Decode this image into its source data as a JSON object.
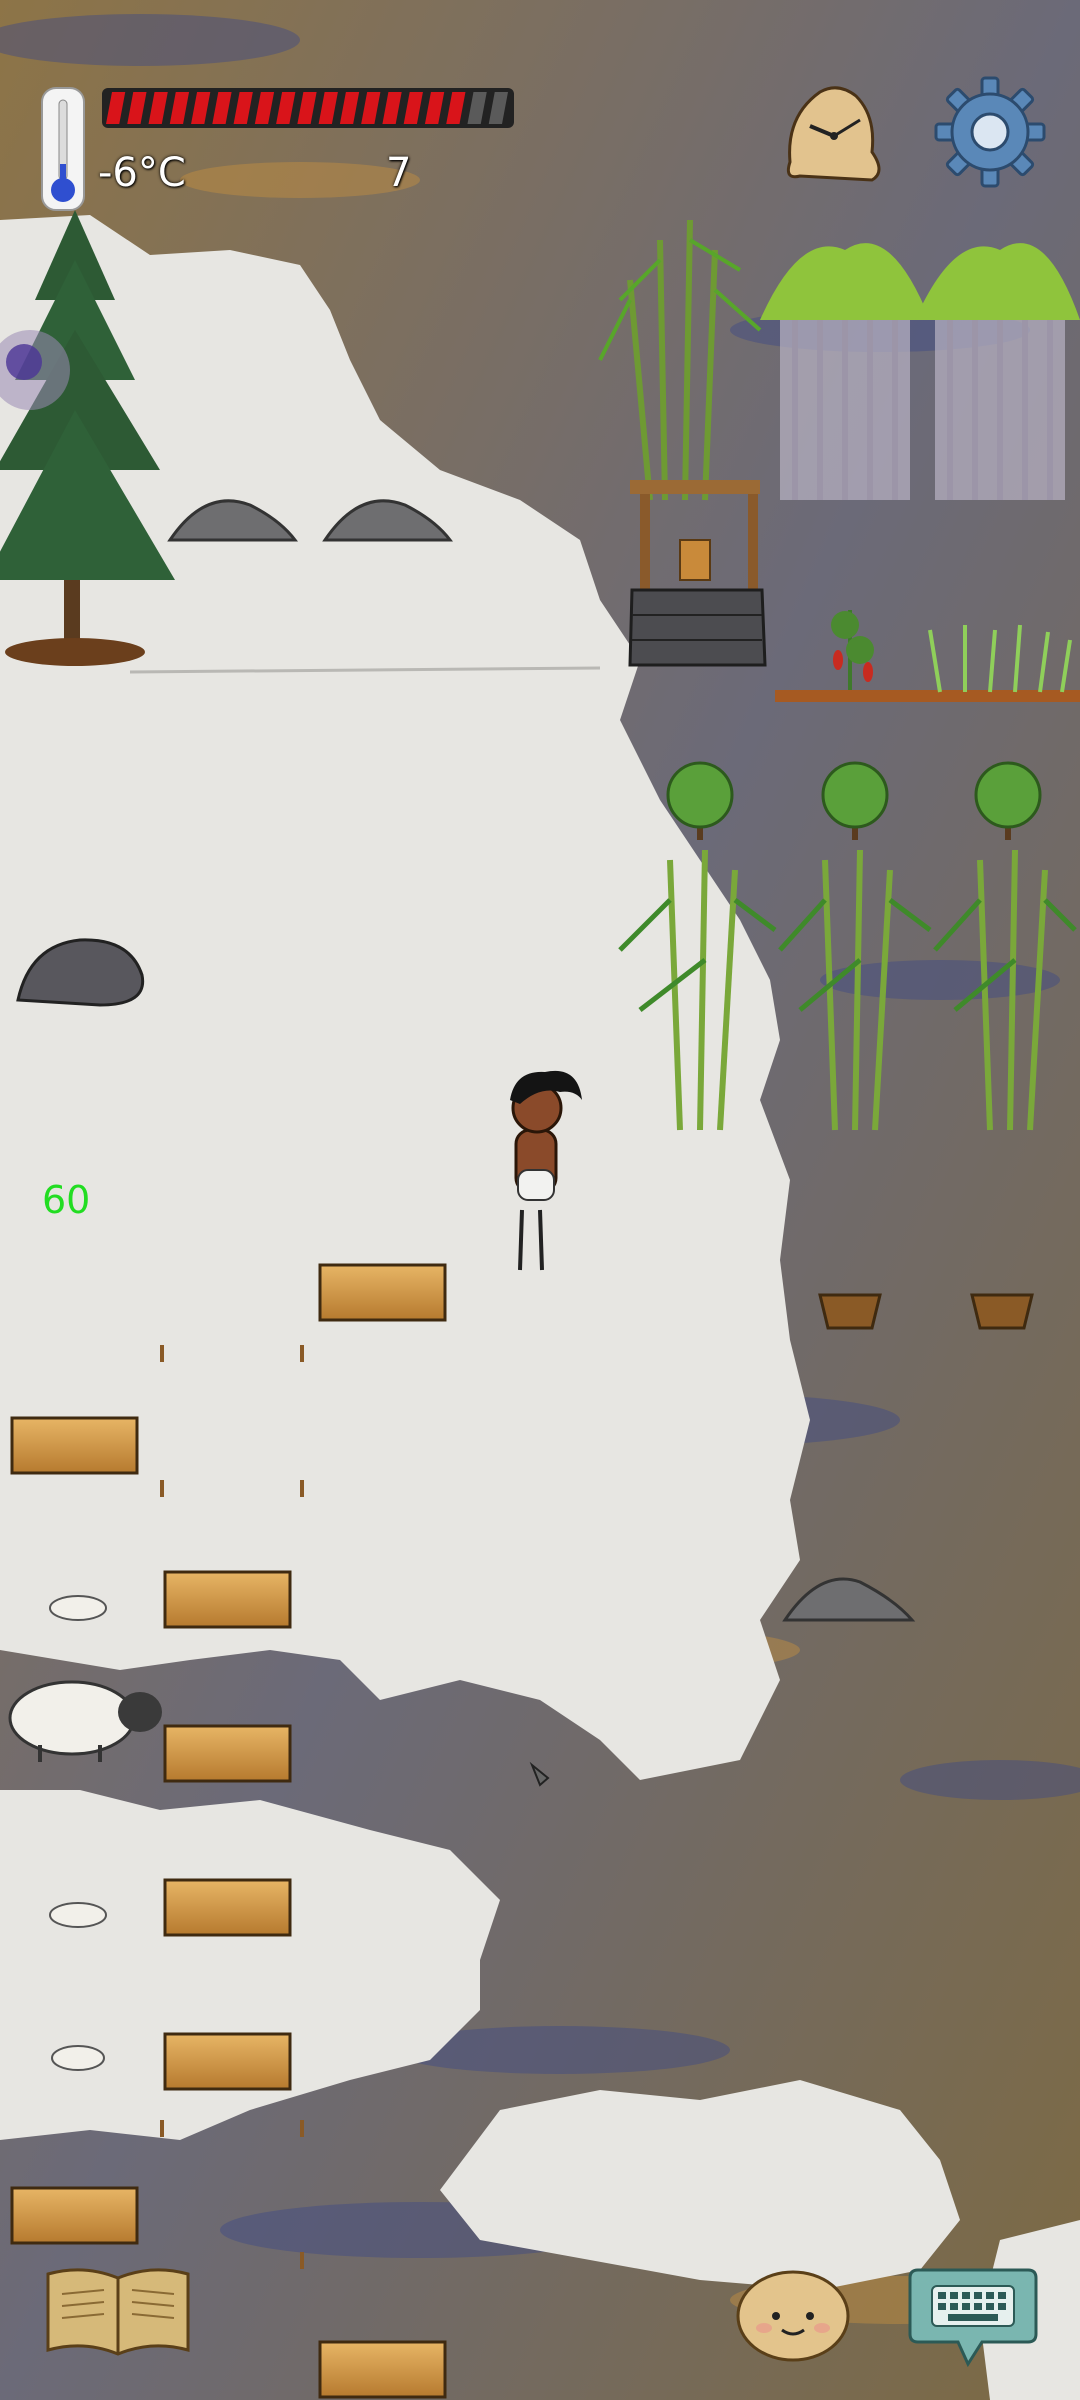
{
  "hud": {
    "temperature": "-6°C",
    "age": "7",
    "food_meter": {
      "filled": 17,
      "total": 19
    },
    "fps": "60"
  },
  "icons": {
    "thermometer": "thermometer-icon",
    "clock": "melting-clock-icon",
    "settings": "gear-icon",
    "tech_book": "book-icon",
    "emote": "emote-face-icon",
    "chat": "keyboard-chat-icon"
  },
  "colors": {
    "food_fill": "#d9141a",
    "food_empty": "#5a5a5a",
    "fps_text": "#22dd22",
    "gear": "#5a88b8"
  }
}
